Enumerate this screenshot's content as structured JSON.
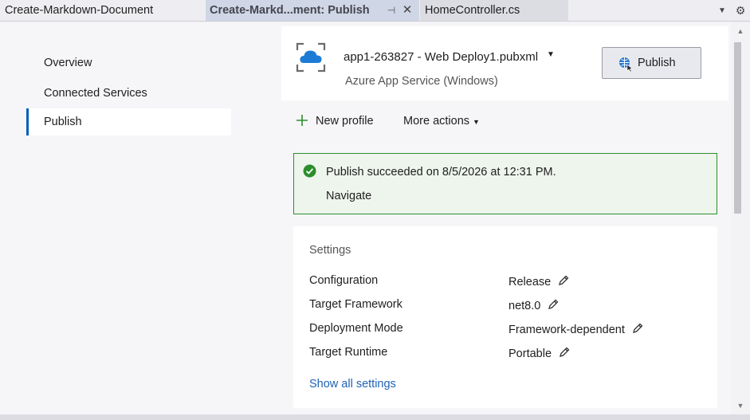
{
  "tabs": [
    {
      "label": "Create-Markdown-Document"
    },
    {
      "label": "Create-Markd...ment: Publish",
      "active": true,
      "pin_icon": "pin-icon",
      "close_icon": "close-icon"
    },
    {
      "label": "HomeController.cs"
    }
  ],
  "tab_strip": {
    "dropdown_icon": "chevron-down-icon",
    "settings_icon": "gear-icon"
  },
  "nav": {
    "items": [
      {
        "label": "Overview"
      },
      {
        "label": "Connected Services"
      },
      {
        "label": "Publish",
        "selected": true
      }
    ]
  },
  "profile": {
    "name": "app1-263827 - Web Deploy1.pubxml",
    "target": "Azure App Service (Windows)",
    "icon": "azure-app-service-icon",
    "publish_button": "Publish"
  },
  "actions": {
    "new_profile": "New profile",
    "more_actions": "More actions"
  },
  "status": {
    "message": "Publish succeeded on 8/5/2026 at 12:31 PM.",
    "navigate": "Navigate",
    "icon": "check-circle-icon"
  },
  "settings": {
    "title": "Settings",
    "rows": [
      {
        "key": "Configuration",
        "value": "Release"
      },
      {
        "key": "Target Framework",
        "value": "net8.0"
      },
      {
        "key": "Deployment Mode",
        "value": "Framework-dependent"
      },
      {
        "key": "Target Runtime",
        "value": "Portable"
      }
    ],
    "show_all": "Show all settings"
  },
  "colors": {
    "accent": "#005fb8",
    "success_border": "#2c8d2c",
    "success_bg": "#eef5ed",
    "link": "#1f62b4"
  }
}
